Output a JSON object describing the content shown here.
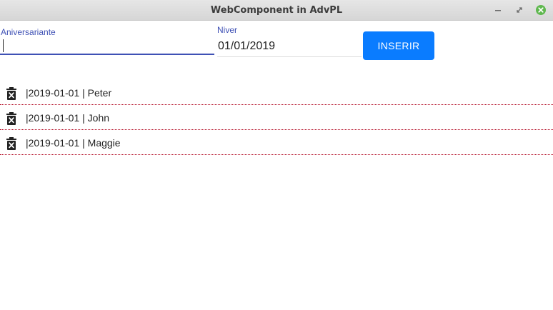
{
  "window": {
    "title": "WebComponent in AdvPL",
    "controls": [
      "minimize-icon",
      "maximize-icon",
      "close-icon"
    ],
    "close_color": "#5fb84f"
  },
  "form": {
    "aniversariante": {
      "label": "Aniversariante",
      "value": ""
    },
    "niver": {
      "label": "Niver",
      "value": "01/01/2019"
    },
    "inserir_label": "INSERIR",
    "accent": "#3f51b5",
    "button_color": "#0a7cff"
  },
  "list": {
    "icon": "delete-icon",
    "items": [
      {
        "text": "|2019-01-01 | Peter"
      },
      {
        "text": "|2019-01-01 | John"
      },
      {
        "text": "|2019-01-01 | Maggie"
      }
    ],
    "separator_color": "#b0001a"
  }
}
